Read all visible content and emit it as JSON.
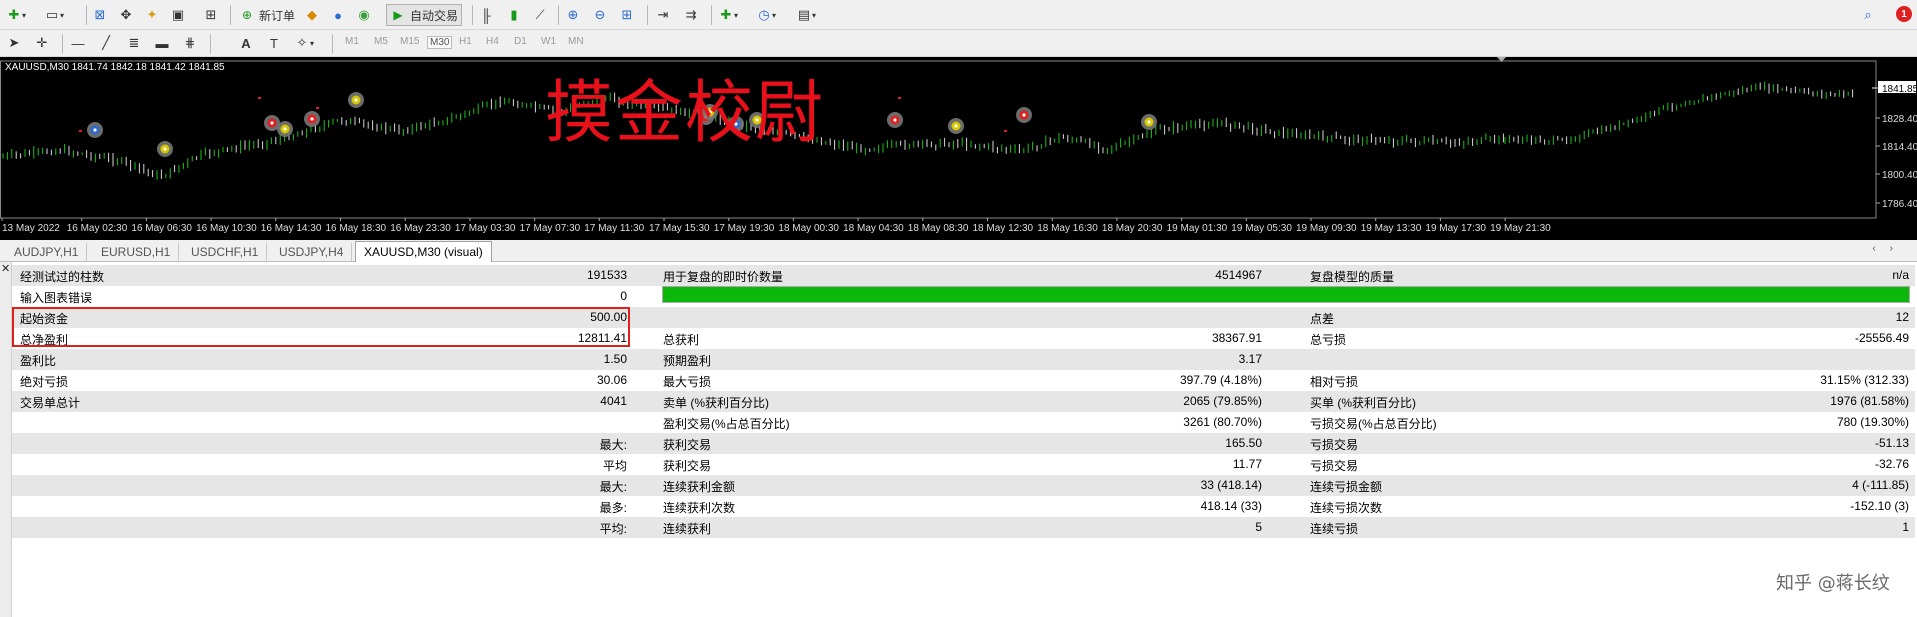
{
  "toolbar": {
    "new_order_label": "新订单",
    "auto_trade_label": "自动交易",
    "timeframes": [
      "M1",
      "M5",
      "M15",
      "M30",
      "H1",
      "H4",
      "D1",
      "W1",
      "MN"
    ],
    "active_timeframe": "M30",
    "notification_count": "1"
  },
  "chart": {
    "title": "XAUUSD,M30  1841.74 1842.18 1841.42 1841.85",
    "watermark": "摸金校尉",
    "price_labels": [
      "1841.85",
      "1828.40",
      "1814.40",
      "1800.40",
      "1786.40"
    ],
    "time_labels": [
      "13 May 2022",
      "16 May 02:30",
      "16 May 06:30",
      "16 May 10:30",
      "16 May 14:30",
      "16 May 18:30",
      "16 May 23:30",
      "17 May 03:30",
      "17 May 07:30",
      "17 May 11:30",
      "17 May 15:30",
      "17 May 19:30",
      "18 May 00:30",
      "18 May 04:30",
      "18 May 08:30",
      "18 May 12:30",
      "18 May 16:30",
      "18 May 20:30",
      "19 May 01:30",
      "19 May 05:30",
      "19 May 09:30",
      "19 May 13:30",
      "19 May 17:30",
      "19 May 21:30"
    ],
    "colors": {
      "background": "#000000",
      "bull": "#19c219",
      "current_price": "#ffffff"
    }
  },
  "tabs": [
    "AUDJPY,H1",
    "EURUSD,H1",
    "USDCHF,H1",
    "USDJPY,H4",
    "XAUUSD,M30 (visual)"
  ],
  "active_tab": "XAUUSD,M30 (visual)",
  "report": {
    "r1": {
      "l1": "经测试过的柱数",
      "v1": "191533",
      "l2": "用于复盘的即时价数量",
      "v2": "4514967",
      "l3": "复盘模型的质量",
      "v3": "n/a"
    },
    "r2": {
      "l1": "输入图表错误",
      "v1": "0"
    },
    "r3": {
      "l1": "起始资金",
      "v1": "500.00",
      "l3": "点差",
      "v3": "12"
    },
    "r4": {
      "l1": "总净盈利",
      "v1": "12811.41",
      "l2": "总获利",
      "v2": "38367.91",
      "l3": "总亏损",
      "v3": "-25556.49"
    },
    "r5": {
      "l1": "盈利比",
      "v1": "1.50",
      "l2": "预期盈利",
      "v2": "3.17"
    },
    "r6": {
      "l1": "绝对亏损",
      "v1": "30.06",
      "l2": "最大亏损",
      "v2": "397.79 (4.18%)",
      "l3": "相对亏损",
      "v3": "31.15% (312.33)"
    },
    "r7": {
      "l1": "交易单总计",
      "v1": "4041",
      "l2": "卖单 (%获利百分比)",
      "v2": "2065 (79.85%)",
      "l3": "买单 (%获利百分比)",
      "v3": "1976 (81.58%)"
    },
    "r8": {
      "l2": "盈利交易(%占总百分比)",
      "v2": "3261 (80.70%)",
      "l3": "亏损交易(%占总百分比)",
      "v3": "780 (19.30%)"
    },
    "r9": {
      "v1": "最大:",
      "l2": "获利交易",
      "v2": "165.50",
      "l3": "亏损交易",
      "v3": "-51.13"
    },
    "r10": {
      "v1": "平均",
      "l2": "获利交易",
      "v2": "11.77",
      "l3": "亏损交易",
      "v3": "-32.76"
    },
    "r11": {
      "v1": "最大:",
      "l2": "连续获利金额",
      "v2": "33 (418.14)",
      "l3": "连续亏损金额",
      "v3": "4 (-111.85)"
    },
    "r12": {
      "v1": "最多:",
      "l2": "连续获利次数",
      "v2": "418.14 (33)",
      "l3": "连续亏损次数",
      "v3": "-152.10 (3)"
    },
    "r13": {
      "v1": "平均:",
      "l2": "连续获利",
      "v2": "5",
      "l3": "连续亏损",
      "v3": "1"
    },
    "progress_fraction": 1.0,
    "progress_color": "#0db80d"
  },
  "footer_watermark": "知乎 @蒋长纹"
}
